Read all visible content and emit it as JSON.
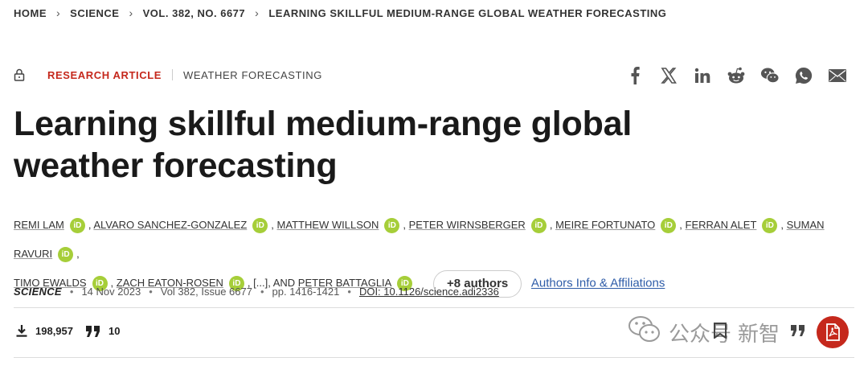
{
  "breadcrumb": [
    {
      "label": "HOME"
    },
    {
      "label": "SCIENCE"
    },
    {
      "label": "VOL. 382, NO. 6677"
    },
    {
      "label": "LEARNING SKILLFUL MEDIUM-RANGE GLOBAL WEATHER FORECASTING"
    }
  ],
  "article": {
    "type": "RESEARCH ARTICLE",
    "topic": "WEATHER FORECASTING",
    "title": "Learning skillful medium-range global weather forecasting"
  },
  "share_icons": [
    "facebook-icon",
    "x-icon",
    "linkedin-icon",
    "reddit-icon",
    "wechat-icon",
    "whatsapp-icon",
    "email-icon"
  ],
  "authors": {
    "list": [
      "REMI LAM",
      "ALVARO SANCHEZ-GONZALEZ",
      "MATTHEW WILLSON",
      "PETER WIRNSBERGER",
      "MEIRE FORTUNATO",
      "FERRAN ALET",
      "SUMAN RAVURI",
      "TIMO EWALDS",
      "ZACH EATON-ROSEN",
      "PETER BATTAGLIA"
    ],
    "ellipsis": "[...], AND",
    "more_button": "+8 authors",
    "affiliations_link": "Authors Info & Affiliations"
  },
  "publication": {
    "journal": "SCIENCE",
    "date": "14 Nov 2023",
    "volume": "Vol 382, Issue 6677",
    "pages": "pp. 1416-1421",
    "doi": "DOI: 10.1126/science.adi2336"
  },
  "metrics": {
    "downloads": "198,957",
    "citations": "10"
  },
  "watermark": {
    "text": "公众号",
    "text2": "新智"
  },
  "colors": {
    "accent": "#c5281c",
    "orcid": "#a6ce39",
    "link": "#2e5ca8"
  }
}
